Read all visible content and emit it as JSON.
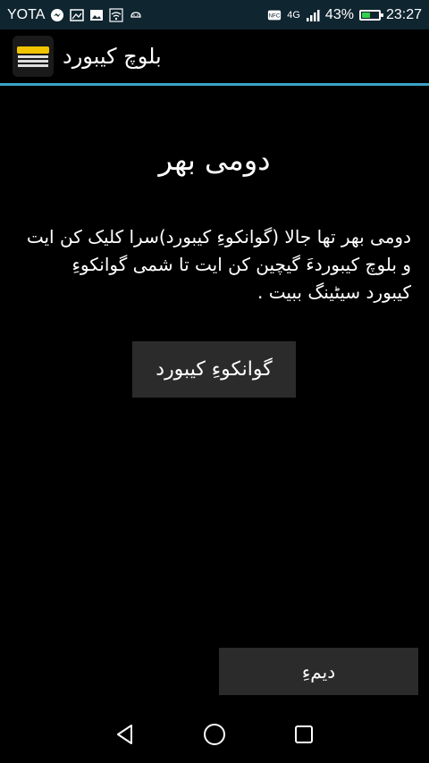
{
  "status_bar": {
    "carrier": "YOTA",
    "network": "4G",
    "battery_text": "43%",
    "battery_level": 0.43,
    "time": "23:27",
    "icons": [
      "messenger-icon",
      "image-icon",
      "gallery-icon",
      "wifi-icon",
      "android-icon",
      "nfc-icon",
      "signal-icon",
      "battery-icon"
    ]
  },
  "action_bar": {
    "title": "بلوچ کیبورد",
    "icon": "app-logo-icon",
    "accent_color": "#3aa3c6"
  },
  "main": {
    "title": "دومی بھر",
    "description": "دومی بھر تھا جالا (گوانکوءِ کیبورد)سرا کلیک کن ایت و بلوچ کیبوردءَ گیچین کن ایت تا شمی گوانکوءِ کیبورد سیٹینگ ببیت .",
    "keyboard_button_label": "گوانکوءِ کیبورد",
    "next_button_label": "دیمءِ"
  },
  "nav_bar": {
    "icons": [
      "back-icon",
      "home-icon",
      "recents-icon"
    ]
  }
}
